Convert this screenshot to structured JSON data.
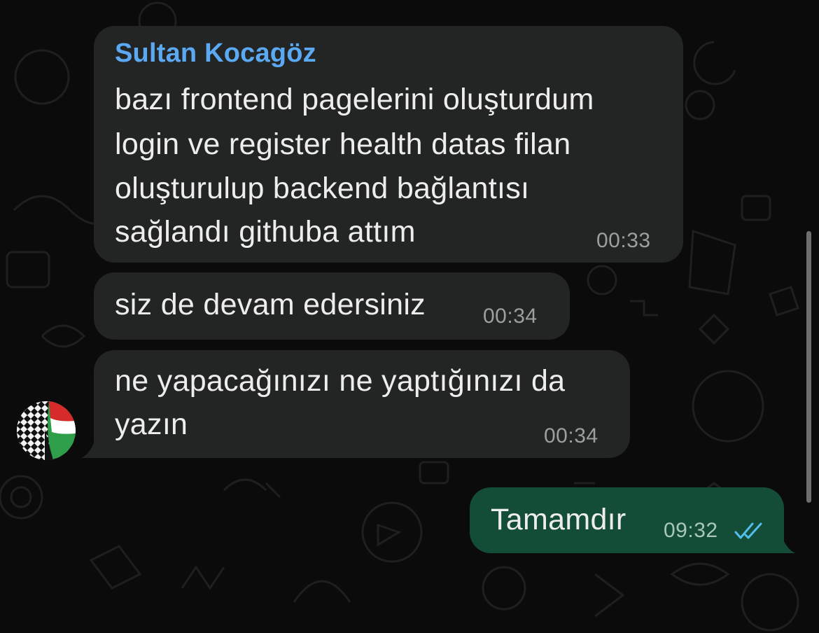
{
  "chat": {
    "messages": [
      {
        "sender": "Sultan Kocagöz",
        "lines": [
          "bazı frontend pagelerini oluşturdum",
          "login ve register health datas filan",
          "oluşturulup backend bağlantısı",
          "sağlandı githuba attım"
        ],
        "time": "00:33"
      },
      {
        "lines": [
          "siz de devam edersiniz"
        ],
        "time": "00:34"
      },
      {
        "lines": [
          "ne yapacağınızı ne yaptığınızı da",
          "yazın"
        ],
        "time": "00:34"
      },
      {
        "lines": [
          "Tamamdır"
        ],
        "time": "09:32",
        "status": "read"
      }
    ]
  },
  "colors": {
    "background": "#0b0b0b",
    "incoming_bubble": "#232424",
    "outgoing_bubble": "#144d37",
    "sender_name": "#5aa9f2",
    "read_ticks": "#53bdeb"
  },
  "icons": {
    "read_receipt": "double-check-icon",
    "avatar": "contact-avatar"
  }
}
